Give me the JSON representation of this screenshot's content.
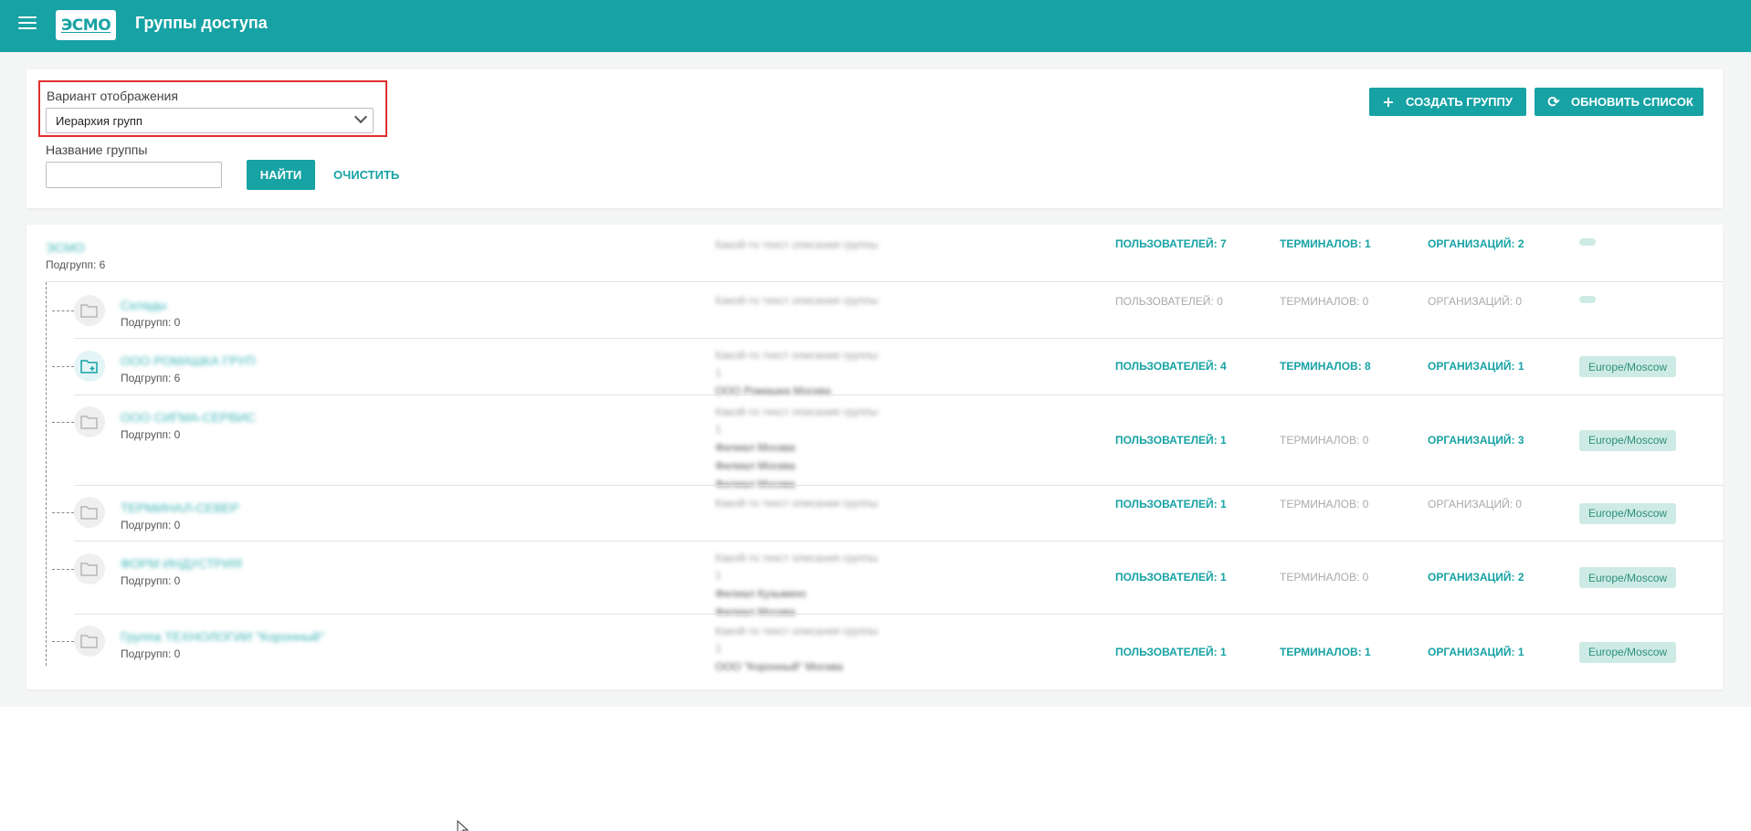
{
  "header": {
    "title": "Группы доступа",
    "logo_text": "ЭСМО",
    "accent_color": "#17a2a4"
  },
  "filters": {
    "display_label": "Вариант отображения",
    "display_value": "Иерархия групп",
    "name_label": "Название группы",
    "name_value": "",
    "find_label": "НАЙТИ",
    "clear_label": "ОЧИСТИТЬ",
    "create_label": "СОЗДАТЬ ГРУППУ",
    "refresh_label": "ОБНОВИТЬ СПИСОК"
  },
  "root": {
    "name": "ЭСМО",
    "subgroups": "Подгрупп: 6",
    "desc": "Какой-то текст описания группы",
    "users": "ПОЛЬЗОВАТЕЛЕЙ: 7",
    "terminals": "ТЕРМИНАЛОВ: 1",
    "orgs": "ОРГАНИЗАЦИЙ: 2"
  },
  "groups": [
    {
      "name": "Склады",
      "subgroups": "Подгрупп: 0",
      "desc": [
        "Какой-то текст описания группы"
      ],
      "users": "ПОЛЬЗОВАТЕЛЕЙ: 0",
      "terminals": "ТЕРМИНАЛОВ: 0",
      "orgs": "ОРГАНИЗАЦИЙ: 0",
      "tz": ""
    },
    {
      "name": "ООО РОМАШКА ГРУП",
      "subgroups": "Подгрупп: 6",
      "desc": [
        "Какой-то текст описания группы 1",
        "ООО Ромашка Москва"
      ],
      "users": "ПОЛЬЗОВАТЕЛЕЙ: 4",
      "terminals": "ТЕРМИНАЛОВ: 8",
      "orgs": "ОРГАНИЗАЦИЙ: 1",
      "tz": "Europe/Moscow"
    },
    {
      "name": "ООО СИГМА-СЕРВИС",
      "subgroups": "Подгрупп: 0",
      "desc": [
        "Какой-то текст описания группы 1",
        "Филиал Москва",
        "Филиал Москва",
        "Филиал Москва"
      ],
      "users": "ПОЛЬЗОВАТЕЛЕЙ: 1",
      "terminals": "ТЕРМИНАЛОВ: 0",
      "orgs": "ОРГАНИЗАЦИЙ: 3",
      "tz": "Europe/Moscow"
    },
    {
      "name": "ТЕРМИНАЛ-СЕВЕР",
      "subgroups": "Подгрупп: 0",
      "desc": [
        "Какой-то текст описания группы"
      ],
      "users": "ПОЛЬЗОВАТЕЛЕЙ: 1",
      "terminals": "ТЕРМИНАЛОВ: 0",
      "orgs": "ОРГАНИЗАЦИЙ: 0",
      "tz": "Europe/Moscow"
    },
    {
      "name": "ФОРМ ИНДУСТРИЯ",
      "subgroups": "Подгрупп: 0",
      "desc": [
        "Какой-то текст описания группы 1",
        "Филиал Кузьмино",
        "Филиал Москва"
      ],
      "users": "ПОЛЬЗОВАТЕЛЕЙ: 1",
      "terminals": "ТЕРМИНАЛОВ: 0",
      "orgs": "ОРГАНИЗАЦИЙ: 2",
      "tz": "Europe/Moscow"
    },
    {
      "name": "Группа ТЕХНОЛОГИИ \"Коронный\"",
      "subgroups": "Подгрупп: 0",
      "desc": [
        "Какой-то текст описания группы 1",
        "ООО \"Коронный\" Москва"
      ],
      "users": "ПОЛЬЗОВАТЕЛЕЙ: 1",
      "terminals": "ТЕРМИНАЛОВ: 1",
      "orgs": "ОРГАНИЗАЦИЙ: 1",
      "tz": "Europe/Moscow"
    }
  ]
}
